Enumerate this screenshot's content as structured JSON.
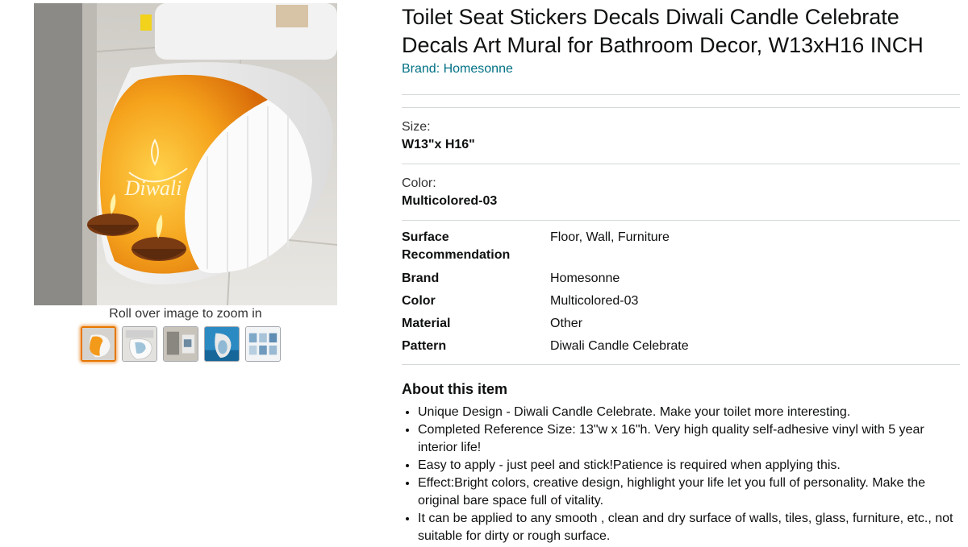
{
  "gallery": {
    "zoom_hint": "Roll over image to zoom in",
    "main_image_icon": "toilet-seat-diwali-decal-photo",
    "main_image_text": "Diwali",
    "thumbnails": [
      {
        "icon": "toilet-orange-decal-thumb",
        "selected": true
      },
      {
        "icon": "toilet-white-thumb",
        "selected": false
      },
      {
        "icon": "bathroom-scene-thumb",
        "selected": false
      },
      {
        "icon": "toilet-blue-decal-thumb",
        "selected": false
      },
      {
        "icon": "decal-variants-thumb",
        "selected": false
      }
    ]
  },
  "product": {
    "title": "Toilet Seat Stickers Decals Diwali Candle Celebrate Decals Art Mural for Bathroom Decor, W13xH16 INCH",
    "brand_link": "Brand: Homesonne"
  },
  "variations": {
    "size_label": "Size:",
    "size_value": "W13\"x H16\"",
    "color_label": "Color:",
    "color_value": "Multicolored-03"
  },
  "specs": [
    {
      "key": "Surface Recommendation",
      "value": "Floor, Wall, Furniture"
    },
    {
      "key": "Brand",
      "value": "Homesonne"
    },
    {
      "key": "Color",
      "value": "Multicolored-03"
    },
    {
      "key": "Material",
      "value": "Other"
    },
    {
      "key": "Pattern",
      "value": "Diwali Candle Celebrate"
    }
  ],
  "about": {
    "heading": "About this item",
    "bullets": [
      "Unique Design - Diwali Candle Celebrate. Make your toilet more interesting.",
      "Completed Reference Size: 13\"w x 16\"h. Very high quality self-adhesive vinyl with 5 year interior life!",
      "Easy to apply - just peel and stick!Patience is required when applying this.",
      "Effect:Bright colors, creative design, highlight your life let you full of personality. Make the original bare space full of vitality.",
      "It can be applied to any smooth , clean and dry surface of walls, tiles, glass, furniture, etc., not suitable for dirty or rough surface."
    ]
  },
  "colors": {
    "link": "#007185",
    "selected_thumb_border": "#e77600",
    "decal_orange": "#f39a1a"
  }
}
